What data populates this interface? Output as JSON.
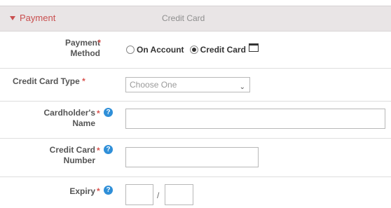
{
  "header": {
    "toggle_label": "Payment",
    "summary": "Credit Card"
  },
  "payment_method": {
    "label": "Payment Method",
    "required": "*",
    "options": [
      {
        "label": "On Account",
        "selected": false
      },
      {
        "label": "Credit Card",
        "selected": true
      }
    ],
    "icon": "credit-card-icon"
  },
  "card_type": {
    "label": "Credit Card Type",
    "required": "*",
    "selected_value": "Choose One",
    "icon": "chevron-down-icon"
  },
  "cardholder": {
    "label_line1": "Cardholder's",
    "label_line2": "Name",
    "required": "*",
    "help": "?",
    "value": ""
  },
  "card_number": {
    "label_line1": "Credit Card",
    "label_line2": "Number",
    "required": "*",
    "help": "?",
    "value": ""
  },
  "expiry": {
    "label": "Expiry",
    "required": "*",
    "help": "?",
    "separator": "/",
    "month_value": "",
    "year_value": ""
  },
  "colors": {
    "accent": "#c94f4f",
    "help_icon": "#2f8fd8",
    "required": "#d9534f"
  }
}
